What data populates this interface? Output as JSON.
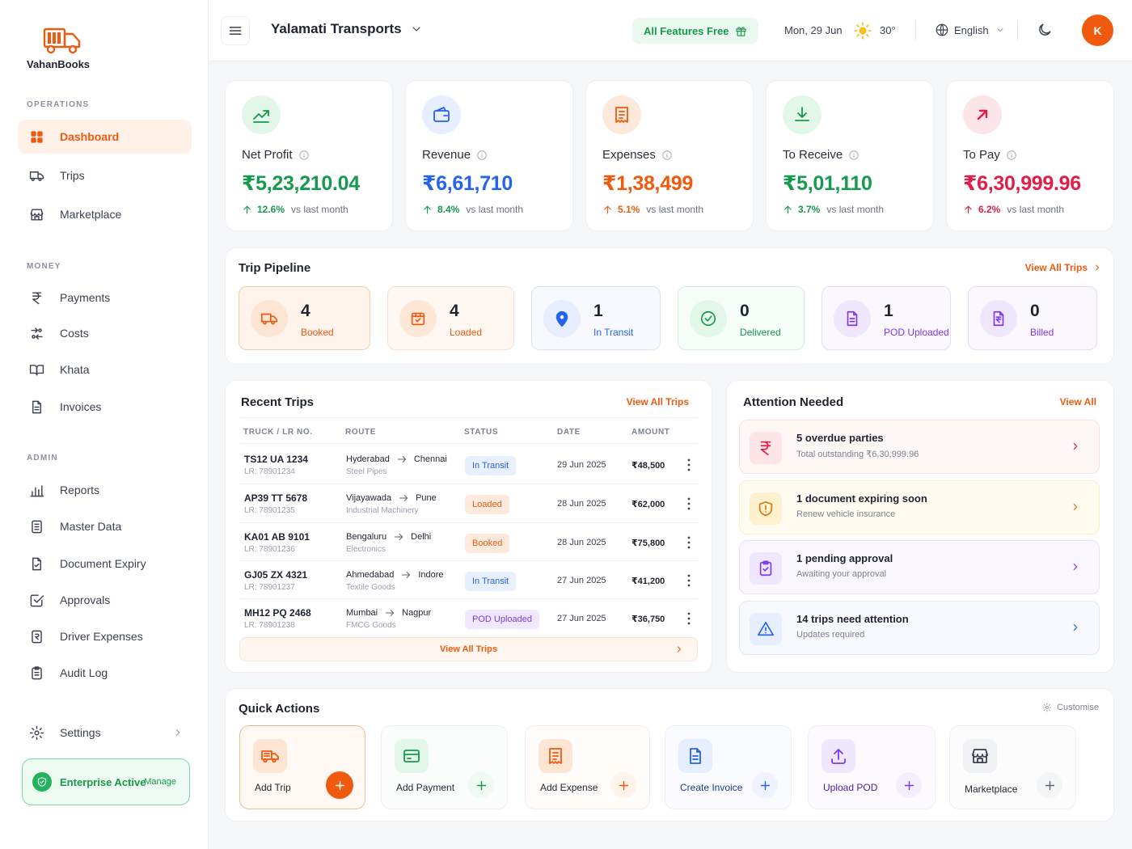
{
  "brand": {
    "name": "VahanBooks",
    "accent": "#f05a0e"
  },
  "sidebar": {
    "sections": {
      "operations": "OPERATIONS",
      "money": "MONEY",
      "admin": "ADMIN"
    },
    "items": [
      {
        "label": "Dashboard",
        "icon": "dashboard-grid-icon",
        "active": true
      },
      {
        "label": "Trips",
        "icon": "truck-icon"
      },
      {
        "label": "Marketplace",
        "icon": "store-icon"
      },
      {
        "label": "Payments",
        "icon": "rupee-icon"
      },
      {
        "label": "Costs",
        "icon": "exchange-icon"
      },
      {
        "label": "Khata",
        "icon": "book-open-icon"
      },
      {
        "label": "Invoices",
        "icon": "file-icon"
      },
      {
        "label": "Reports",
        "icon": "bar-chart-icon"
      },
      {
        "label": "Master Data",
        "icon": "database-icon"
      },
      {
        "label": "Document Expiry",
        "icon": "file-clock-icon"
      },
      {
        "label": "Approvals",
        "icon": "check-square-icon"
      },
      {
        "label": "Driver Expenses",
        "icon": "receipt-icon"
      },
      {
        "label": "Audit Log",
        "icon": "clipboard-icon"
      }
    ],
    "settings": "Settings",
    "enterprise": {
      "label": "Enterprise Active",
      "manage": "Manage"
    }
  },
  "header": {
    "company": "Yalamati Transports",
    "features_button": "All Features Free",
    "date": "Mon, 29 Jun",
    "temperature": "30°",
    "language": "English",
    "avatar_initial": "K"
  },
  "stats": [
    {
      "label": "Net Profit",
      "value": "₹5,23,210.04",
      "change": "12.6%",
      "suffix": "vs last month",
      "color": "#169a4b",
      "icon": "trend-up-icon"
    },
    {
      "label": "Revenue",
      "value": "₹6,61,710",
      "change": "8.4%",
      "suffix": "vs last month",
      "color": "#2563eb",
      "icon": "wallet-icon"
    },
    {
      "label": "Expenses",
      "value": "₹1,38,499",
      "change": "5.1%",
      "suffix": "vs last month",
      "color": "#f05a0e",
      "icon": "receipt-icon"
    },
    {
      "label": "To Receive",
      "value": "₹5,01,110",
      "change": "3.7%",
      "suffix": "vs last month",
      "color": "#169a4b",
      "icon": "download-icon"
    },
    {
      "label": "To Pay",
      "value": "₹6,30,999.96",
      "change": "6.2%",
      "suffix": "vs last month",
      "color": "#e11d48",
      "icon": "arrow-up-right-icon"
    }
  ],
  "pipeline": {
    "title": "Trip Pipeline",
    "view_all": "View All Trips",
    "stages": [
      {
        "count": "4",
        "label": "Booked",
        "color": "#f05a0e"
      },
      {
        "count": "4",
        "label": "Loaded",
        "color": "#f05a0e"
      },
      {
        "count": "1",
        "label": "In Transit",
        "color": "#2563eb"
      },
      {
        "count": "0",
        "label": "Delivered",
        "color": "#169a4b"
      },
      {
        "count": "1",
        "label": "POD Uploaded",
        "color": "#7c3aed"
      },
      {
        "count": "0",
        "label": "Billed",
        "color": "#7c3aed"
      }
    ]
  },
  "recent_trips": {
    "title": "Recent Trips",
    "view_all": "View All Trips",
    "columns": [
      "TRUCK / LR NO.",
      "ROUTE",
      "STATUS",
      "DATE",
      "AMOUNT"
    ],
    "rows": [
      {
        "truck": "TS12 UA 1234",
        "lr": "LR: 78901234",
        "from": "Hyderabad",
        "to": "Chennai",
        "goods": "Steel Pipes",
        "status": "In Transit",
        "date": "29 Jun 2025",
        "amount": "₹48,500"
      },
      {
        "truck": "AP39 TT 5678",
        "lr": "LR: 78901235",
        "from": "Vijayawada",
        "to": "Pune",
        "goods": "Industrial Machinery",
        "status": "Loaded",
        "date": "28 Jun 2025",
        "amount": "₹62,000"
      },
      {
        "truck": "KA01 AB 9101",
        "lr": "LR: 78901236",
        "from": "Bengaluru",
        "to": "Delhi",
        "goods": "Electronics",
        "status": "Booked",
        "date": "28 Jun 2025",
        "amount": "₹75,800"
      },
      {
        "truck": "GJ05 ZX 4321",
        "lr": "LR: 78901237",
        "from": "Ahmedabad",
        "to": "Indore",
        "goods": "Textile Goods",
        "status": "In Transit",
        "date": "27 Jun 2025",
        "amount": "₹41,200"
      },
      {
        "truck": "MH12 PQ 2468",
        "lr": "LR: 78901238",
        "from": "Mumbai",
        "to": "Nagpur",
        "goods": "FMCG Goods",
        "status": "POD Uploaded",
        "date": "27 Jun 2025",
        "amount": "₹36,750"
      }
    ],
    "footer_link": "View All Trips"
  },
  "attention": {
    "title": "Attention Needed",
    "view_all": "View All",
    "items": [
      {
        "title": "5 overdue parties",
        "subtitle": "Total outstanding ₹6,30,999.96",
        "icon": "rupee-icon",
        "color": "#e11d48"
      },
      {
        "title": "1 document expiring soon",
        "subtitle": "Renew vehicle insurance",
        "icon": "shield-alert-icon",
        "color": "#d97706"
      },
      {
        "title": "1 pending approval",
        "subtitle": "Awaiting your approval",
        "icon": "clipboard-check-icon",
        "color": "#7c3aed"
      },
      {
        "title": "14 trips need attention",
        "subtitle": "Updates required",
        "icon": "warning-triangle-icon",
        "color": "#2563eb"
      }
    ]
  },
  "quick_actions": {
    "title": "Quick Actions",
    "customise": "Customise",
    "items": [
      {
        "label": "Add Trip",
        "icon": "truck-icon"
      },
      {
        "label": "Add Payment",
        "icon": "card-icon"
      },
      {
        "label": "Add Expense",
        "icon": "receipt-icon"
      },
      {
        "label": "Create Invoice",
        "icon": "file-text-icon"
      },
      {
        "label": "Upload POD",
        "icon": "upload-icon"
      },
      {
        "label": "Marketplace",
        "icon": "store-icon"
      }
    ]
  }
}
